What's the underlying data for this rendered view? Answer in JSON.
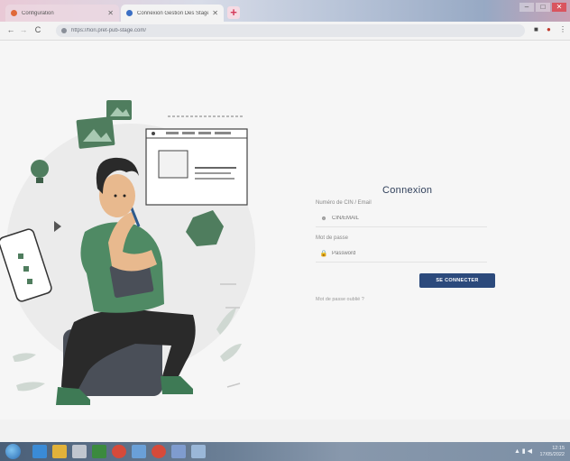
{
  "browser": {
    "tabs": [
      {
        "title": "Configuration",
        "active": false
      },
      {
        "title": "Connexion Gestion Des Stages",
        "active": true
      }
    ],
    "new_tab": "+",
    "url": "https://fiori.pret-pub-stage.com/"
  },
  "login": {
    "title": "Connexion",
    "username_label": "Numéro de CIN / Email",
    "username_placeholder": "CIN/EMAIL",
    "password_label": "Mot de passe",
    "password_placeholder": "Password",
    "submit_label": "SE CONNECTER",
    "forgot_link": "Mot de passe oublié ?"
  },
  "taskbar": {
    "time": "12:15",
    "date": "17/05/2022"
  },
  "colors": {
    "primary_button": "#2c4a7c",
    "title_text": "#2f3f5a",
    "illustration_green": "#4f8a64",
    "browser_close": "#d9545e"
  }
}
